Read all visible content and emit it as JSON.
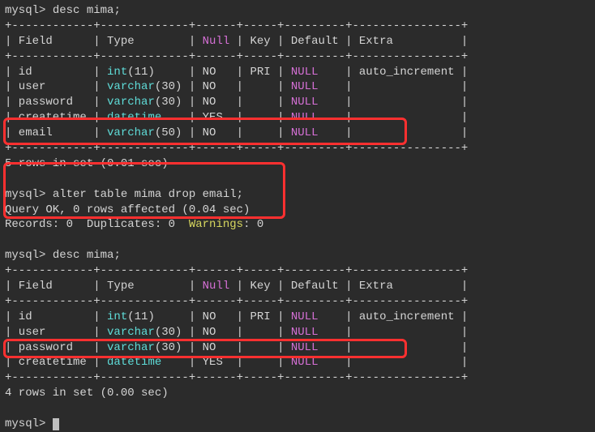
{
  "prompt_prefix": "mysql>",
  "cmd1": "desc mima;",
  "cmd2": "alter table mima drop email;",
  "cmd3": "desc mima;",
  "table1": {
    "border_top": "+------------+-------------+------+-----+---------+----------------+",
    "header_line": "| Field      | Type        | Null | Key | Default | Extra          |",
    "border_mid": "+------------+-------------+------+-----+---------+----------------+",
    "rows": [
      {
        "a": "| id         | ",
        "b": "int",
        "c": "(11)     | NO   | PRI | ",
        "d": "NULL",
        "e": "    | auto_increment |"
      },
      {
        "a": "| user       | ",
        "b": "varchar",
        "c": "(30) | NO   |     | ",
        "d": "NULL",
        "e": "    |                |"
      },
      {
        "a": "| password   | ",
        "b": "varchar",
        "c": "(30) | NO   |     | ",
        "d": "NULL",
        "e": "    |                |"
      },
      {
        "a": "| createtime | ",
        "b": "datetime",
        "c": "    | YES  |     | ",
        "d": "NULL",
        "e": "    |                |"
      },
      {
        "a": "| email      | ",
        "b": "varchar",
        "c": "(50) | NO   |     | ",
        "d": "NULL",
        "e": "    |                |"
      }
    ],
    "border_bot": "+------------+-------------+------+-----+---------+----------------+",
    "summary": "5 rows in set (0.01 sec)"
  },
  "alter_result": {
    "line1": "Query OK, 0 rows affected (0.04 sec)",
    "line2_pre": "Records: 0  Duplicates: 0  ",
    "line2_warn": "Warnings",
    "line2_post": ": 0"
  },
  "table2": {
    "border_top": "+------------+-------------+------+-----+---------+----------------+",
    "header_line": "| Field      | Type        | Null | Key | Default | Extra          |",
    "border_mid": "+------------+-------------+------+-----+---------+----------------+",
    "rows": [
      {
        "a": "| id         | ",
        "b": "int",
        "c": "(11)     | NO   | PRI | ",
        "d": "NULL",
        "e": "    | auto_increment |"
      },
      {
        "a": "| user       | ",
        "b": "varchar",
        "c": "(30) | NO   |     | ",
        "d": "NULL",
        "e": "    |                |"
      },
      {
        "a": "| password   | ",
        "b": "varchar",
        "c": "(30) | NO   |     | ",
        "d": "NULL",
        "e": "    |                |"
      },
      {
        "a": "| createtime | ",
        "b": "datetime",
        "c": "    | YES  |     | ",
        "d": "NULL",
        "e": "    |                |"
      }
    ],
    "border_bot": "+------------+-------------+------+-----+---------+----------------+",
    "summary": "4 rows in set (0.00 sec)"
  },
  "null_label": "Null"
}
